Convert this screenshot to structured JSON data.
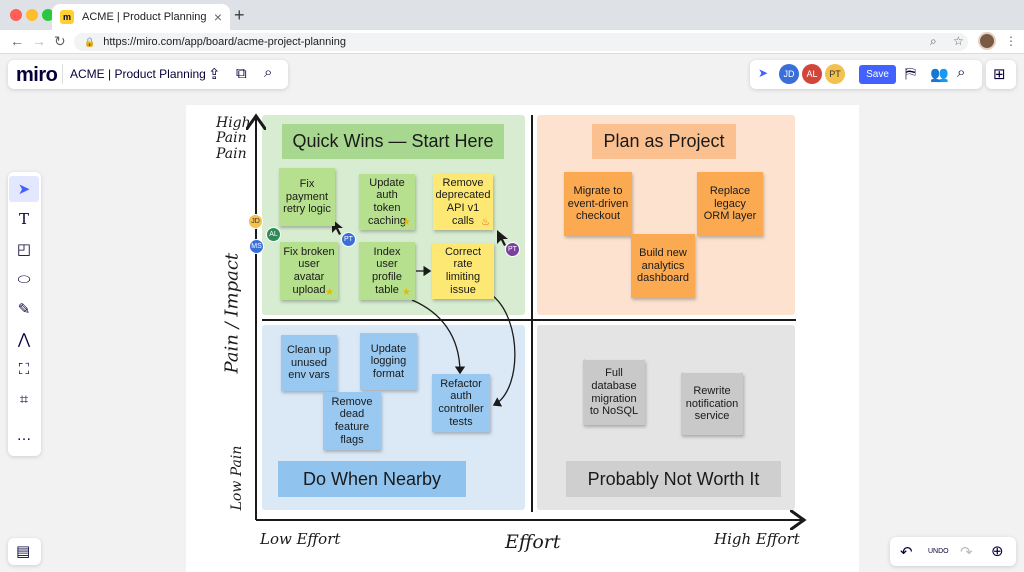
{
  "browser": {
    "tab_title": "ACME | Product Planning - Miro",
    "tab_favicon": "m",
    "url": "https://miro.com/app/board/acme-project-planning"
  },
  "toolbar": {
    "logo": "miro",
    "board_name": "ACME | Product Planning",
    "save_label": "Save"
  },
  "collaborators": [
    {
      "initials": "JD",
      "color": "#3a6fd8"
    },
    {
      "initials": "AL",
      "color": "#d2453b"
    },
    {
      "initials": "PT",
      "color": "#f2c14e"
    }
  ],
  "bottom": {
    "undo_label": "UNDO"
  },
  "axes": {
    "y_label": "Pain / Impact",
    "y_high": "High\nPain\nPain",
    "y_low": "Low Pain",
    "x_label": "Effort",
    "x_low": "Low Effort",
    "x_high": "High Effort"
  },
  "quadrants": {
    "quick_wins": {
      "title": "Quick Wins — Start Here",
      "color": "#d7ecd0",
      "title_color": "#a8d890"
    },
    "plan_project": {
      "title": "Plan as Project",
      "color": "#fde3cf",
      "title_color": "#fbc090"
    },
    "nearby": {
      "title": "Do When Nearby",
      "color": "#dbe8f6",
      "title_color": "#90c4ee"
    },
    "not_worth": {
      "title": "Probably Not Worth It",
      "color": "#e4e4e4",
      "title_color": "#cfcfcf"
    }
  },
  "stickies": {
    "fix_payment": "Fix payment retry logic",
    "update_auth": "Update auth token caching",
    "remove_api": "Remove deprecated API v1 calls",
    "fix_avatar": "Fix broken user avatar upload",
    "index_profile": "Index user profile table",
    "rate_limit": "Correct rate limiting issue",
    "migrate_event": "Migrate to event-driven checkout",
    "replace_orm": "Replace legacy ORM layer",
    "analytics": "Build new analytics dashboard",
    "clean_env": "Clean up unused env vars",
    "update_logging": "Update logging format",
    "remove_flags": "Remove dead feature flags",
    "refactor_auth": "Refactor auth controller tests",
    "nosql": "Full database migration to NoSQL",
    "rewrite_notif": "Rewrite notification service"
  },
  "cursors": {
    "jd": "JD",
    "al": "AL",
    "ms": "MS",
    "pt1": "PT",
    "pt2": "PT"
  },
  "colors": {
    "green_sticky": "#b6e08e",
    "yellow_sticky": "#fde874",
    "orange_sticky": "#fbaa52",
    "blue_sticky": "#99c9f1",
    "gray_sticky": "#c9c9c9",
    "accent": "#4262ff"
  }
}
